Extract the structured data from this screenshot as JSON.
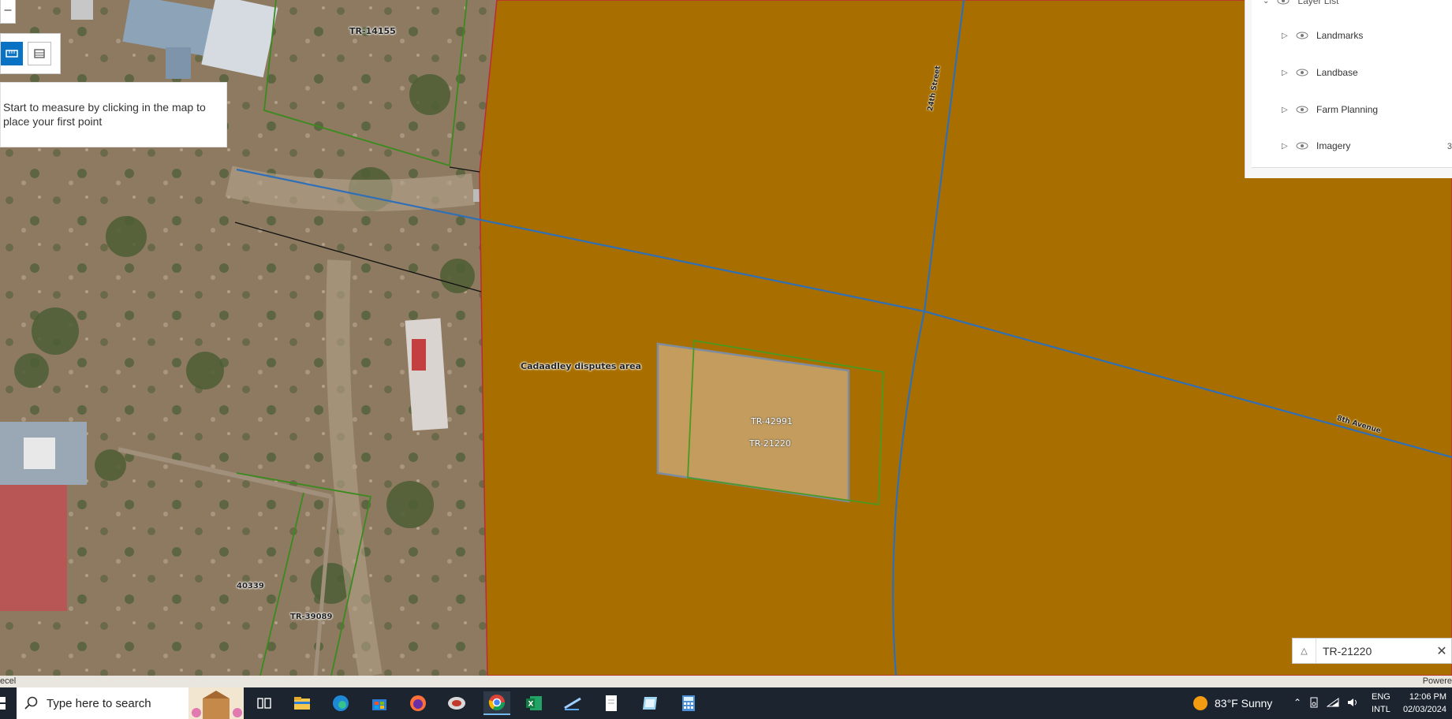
{
  "map": {
    "labels": {
      "tr14155": "TR-14155",
      "disputes_area": "Cadaadley disputes area",
      "tr42991": "TR-42991",
      "tr21220": "TR-21220",
      "p40339": "40339",
      "tr39089": "TR-39089",
      "street_24th": "24th Street",
      "avenue_8th": "8th Avenue"
    },
    "colors": {
      "disputes_fill": "#a86f00",
      "highlight_fill": "#c39c5e",
      "parcel_outline": "#4a9a22",
      "road": "#2e6fb8"
    }
  },
  "measure": {
    "hint": "Start to measure by clicking in the map to place your first point",
    "zoom_out_label": "–",
    "distance_icon": "ruler-icon",
    "area_icon": "area-measure-icon"
  },
  "layer_list": {
    "title": "Layer List",
    "items": [
      {
        "label": "Landmarks"
      },
      {
        "label": "Landbase"
      },
      {
        "label": "Farm Planning"
      },
      {
        "label": "Imagery"
      }
    ],
    "side_text": "3"
  },
  "search": {
    "value": "TR-21220"
  },
  "attribution": {
    "left": "ecel",
    "right": "Powere"
  },
  "taskbar": {
    "search_placeholder": "Type here to search",
    "weather": "83°F  Sunny",
    "lang_line1": "ENG",
    "lang_line2": "INTL",
    "time": "12:06 PM",
    "date": "02/03/2024",
    "apps": [
      "task-view",
      "file-explorer",
      "edge",
      "store",
      "firefox",
      "app-red",
      "chrome",
      "excel",
      "pen",
      "notepad",
      "paper",
      "calculator"
    ]
  }
}
